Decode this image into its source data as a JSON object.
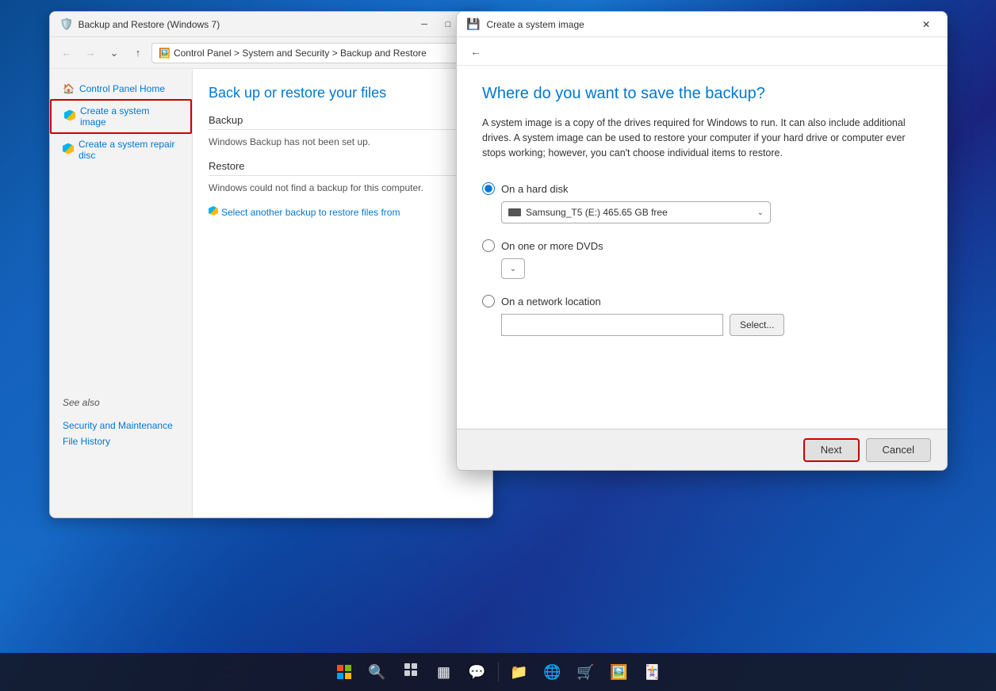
{
  "desktop": {
    "background_color": "#1565c0"
  },
  "backup_window": {
    "title": "Backup and Restore (Windows 7)",
    "nav": {
      "back_disabled": true,
      "forward_disabled": true,
      "address": "Control Panel > System and Security > Backup and Restore"
    },
    "sidebar": {
      "items": [
        {
          "id": "control-panel-home",
          "label": "Control Panel Home",
          "icon": "home"
        },
        {
          "id": "create-system-image",
          "label": "Create a system image",
          "icon": "shield",
          "active": true
        },
        {
          "id": "create-repair-disc",
          "label": "Create a system repair disc",
          "icon": "shield"
        }
      ],
      "see_also_label": "See also",
      "see_also_links": [
        {
          "id": "security-maintenance",
          "label": "Security and Maintenance"
        },
        {
          "id": "file-history",
          "label": "File History"
        }
      ]
    },
    "main": {
      "heading": "Back up or restore your files",
      "backup_section": "Backup",
      "backup_text": "Windows Backup has not been set up.",
      "restore_section": "Restore",
      "restore_text": "Windows could not find a backup for this computer.",
      "restore_link": "Select another backup to restore files from"
    }
  },
  "dialog": {
    "title": "Create a system image",
    "heading": "Where do you want to save the backup?",
    "description": "A system image is a copy of the drives required for Windows to run. It can also include additional drives. A system image can be used to restore your computer if your hard drive or computer ever stops working; however, you can't choose individual items to restore.",
    "options": {
      "hard_disk": {
        "label": "On a hard disk",
        "selected": true,
        "dropdown_value": "Samsung_T5 (E:)  465.65 GB free"
      },
      "dvd": {
        "label": "On one or more DVDs",
        "selected": false
      },
      "network": {
        "label": "On a network location",
        "selected": false,
        "input_placeholder": "",
        "select_btn_label": "Select..."
      }
    },
    "footer": {
      "next_label": "Next",
      "cancel_label": "Cancel"
    }
  },
  "taskbar": {
    "icons": [
      {
        "id": "start",
        "label": "Start",
        "type": "windows"
      },
      {
        "id": "search",
        "label": "Search",
        "type": "search"
      },
      {
        "id": "taskview",
        "label": "Task View",
        "type": "taskview"
      },
      {
        "id": "widgets",
        "label": "Widgets",
        "type": "widgets"
      },
      {
        "id": "chat",
        "label": "Chat",
        "type": "chat"
      },
      {
        "id": "explorer",
        "label": "File Explorer",
        "type": "explorer"
      },
      {
        "id": "edge",
        "label": "Microsoft Edge",
        "type": "edge"
      },
      {
        "id": "store",
        "label": "Microsoft Store",
        "type": "store"
      },
      {
        "id": "photos",
        "label": "Photos",
        "type": "photos"
      },
      {
        "id": "solitaire",
        "label": "Solitaire",
        "type": "solitaire"
      }
    ]
  }
}
